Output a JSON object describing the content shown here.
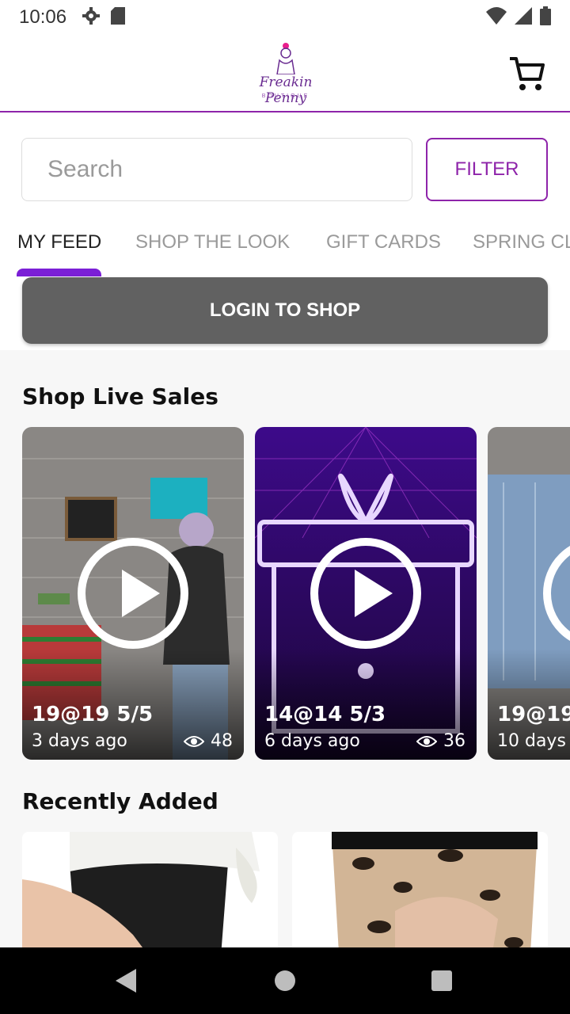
{
  "status_bar": {
    "time": "10:06"
  },
  "header": {
    "logo_text": "Freakin Penny",
    "logo_subtext": "BOUTIQUE"
  },
  "search": {
    "placeholder": "Search",
    "value": ""
  },
  "filter_label": "FILTER",
  "tabs": [
    {
      "label": "MY FEED",
      "active": true
    },
    {
      "label": "SHOP THE LOOK",
      "active": false
    },
    {
      "label": "GIFT CARDS",
      "active": false
    },
    {
      "label": "SPRING CL",
      "active": false
    }
  ],
  "login_label": "LOGIN TO SHOP",
  "live_sales": {
    "title": "Shop Live Sales",
    "cards": [
      {
        "title": "19@19 5/5",
        "time": "3 days ago",
        "views": "48"
      },
      {
        "title": "14@14  5/3",
        "time": "6 days ago",
        "views": "36"
      },
      {
        "title": "19@19",
        "time": "10 days",
        "views": ""
      }
    ]
  },
  "recently_added": {
    "title": "Recently Added"
  },
  "colors": {
    "accent": "#8e24aa",
    "tab_indicator": "#7b1fd6",
    "login_button": "#616161"
  }
}
